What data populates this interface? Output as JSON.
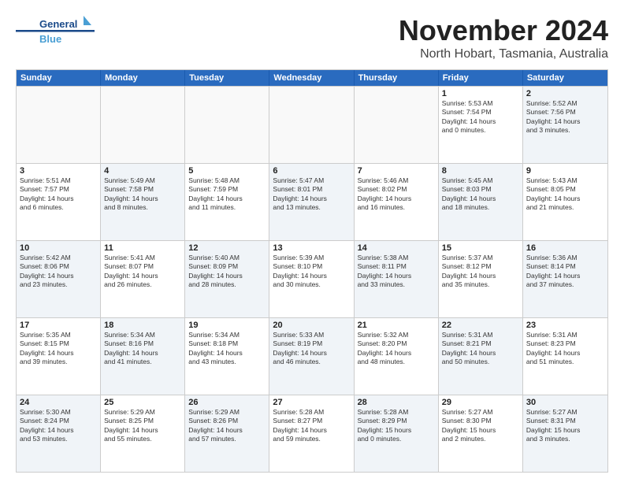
{
  "header": {
    "logo_line1": "General",
    "logo_line2": "Blue",
    "main_title": "November 2024",
    "subtitle": "North Hobart, Tasmania, Australia"
  },
  "calendar": {
    "days_of_week": [
      "Sunday",
      "Monday",
      "Tuesday",
      "Wednesday",
      "Thursday",
      "Friday",
      "Saturday"
    ],
    "rows": [
      [
        {
          "day": "",
          "empty": true
        },
        {
          "day": "",
          "empty": true
        },
        {
          "day": "",
          "empty": true
        },
        {
          "day": "",
          "empty": true
        },
        {
          "day": "",
          "empty": true
        },
        {
          "day": "1",
          "lines": [
            "Sunrise: 5:53 AM",
            "Sunset: 7:54 PM",
            "Daylight: 14 hours",
            "and 0 minutes."
          ]
        },
        {
          "day": "2",
          "lines": [
            "Sunrise: 5:52 AM",
            "Sunset: 7:56 PM",
            "Daylight: 14 hours",
            "and 3 minutes."
          ],
          "shaded": true
        }
      ],
      [
        {
          "day": "3",
          "lines": [
            "Sunrise: 5:51 AM",
            "Sunset: 7:57 PM",
            "Daylight: 14 hours",
            "and 6 minutes."
          ]
        },
        {
          "day": "4",
          "lines": [
            "Sunrise: 5:49 AM",
            "Sunset: 7:58 PM",
            "Daylight: 14 hours",
            "and 8 minutes."
          ],
          "shaded": true
        },
        {
          "day": "5",
          "lines": [
            "Sunrise: 5:48 AM",
            "Sunset: 7:59 PM",
            "Daylight: 14 hours",
            "and 11 minutes."
          ]
        },
        {
          "day": "6",
          "lines": [
            "Sunrise: 5:47 AM",
            "Sunset: 8:01 PM",
            "Daylight: 14 hours",
            "and 13 minutes."
          ],
          "shaded": true
        },
        {
          "day": "7",
          "lines": [
            "Sunrise: 5:46 AM",
            "Sunset: 8:02 PM",
            "Daylight: 14 hours",
            "and 16 minutes."
          ]
        },
        {
          "day": "8",
          "lines": [
            "Sunrise: 5:45 AM",
            "Sunset: 8:03 PM",
            "Daylight: 14 hours",
            "and 18 minutes."
          ],
          "shaded": true
        },
        {
          "day": "9",
          "lines": [
            "Sunrise: 5:43 AM",
            "Sunset: 8:05 PM",
            "Daylight: 14 hours",
            "and 21 minutes."
          ]
        }
      ],
      [
        {
          "day": "10",
          "lines": [
            "Sunrise: 5:42 AM",
            "Sunset: 8:06 PM",
            "Daylight: 14 hours",
            "and 23 minutes."
          ],
          "shaded": true
        },
        {
          "day": "11",
          "lines": [
            "Sunrise: 5:41 AM",
            "Sunset: 8:07 PM",
            "Daylight: 14 hours",
            "and 26 minutes."
          ]
        },
        {
          "day": "12",
          "lines": [
            "Sunrise: 5:40 AM",
            "Sunset: 8:09 PM",
            "Daylight: 14 hours",
            "and 28 minutes."
          ],
          "shaded": true
        },
        {
          "day": "13",
          "lines": [
            "Sunrise: 5:39 AM",
            "Sunset: 8:10 PM",
            "Daylight: 14 hours",
            "and 30 minutes."
          ]
        },
        {
          "day": "14",
          "lines": [
            "Sunrise: 5:38 AM",
            "Sunset: 8:11 PM",
            "Daylight: 14 hours",
            "and 33 minutes."
          ],
          "shaded": true
        },
        {
          "day": "15",
          "lines": [
            "Sunrise: 5:37 AM",
            "Sunset: 8:12 PM",
            "Daylight: 14 hours",
            "and 35 minutes."
          ]
        },
        {
          "day": "16",
          "lines": [
            "Sunrise: 5:36 AM",
            "Sunset: 8:14 PM",
            "Daylight: 14 hours",
            "and 37 minutes."
          ],
          "shaded": true
        }
      ],
      [
        {
          "day": "17",
          "lines": [
            "Sunrise: 5:35 AM",
            "Sunset: 8:15 PM",
            "Daylight: 14 hours",
            "and 39 minutes."
          ]
        },
        {
          "day": "18",
          "lines": [
            "Sunrise: 5:34 AM",
            "Sunset: 8:16 PM",
            "Daylight: 14 hours",
            "and 41 minutes."
          ],
          "shaded": true
        },
        {
          "day": "19",
          "lines": [
            "Sunrise: 5:34 AM",
            "Sunset: 8:18 PM",
            "Daylight: 14 hours",
            "and 43 minutes."
          ]
        },
        {
          "day": "20",
          "lines": [
            "Sunrise: 5:33 AM",
            "Sunset: 8:19 PM",
            "Daylight: 14 hours",
            "and 46 minutes."
          ],
          "shaded": true
        },
        {
          "day": "21",
          "lines": [
            "Sunrise: 5:32 AM",
            "Sunset: 8:20 PM",
            "Daylight: 14 hours",
            "and 48 minutes."
          ]
        },
        {
          "day": "22",
          "lines": [
            "Sunrise: 5:31 AM",
            "Sunset: 8:21 PM",
            "Daylight: 14 hours",
            "and 50 minutes."
          ],
          "shaded": true
        },
        {
          "day": "23",
          "lines": [
            "Sunrise: 5:31 AM",
            "Sunset: 8:23 PM",
            "Daylight: 14 hours",
            "and 51 minutes."
          ]
        }
      ],
      [
        {
          "day": "24",
          "lines": [
            "Sunrise: 5:30 AM",
            "Sunset: 8:24 PM",
            "Daylight: 14 hours",
            "and 53 minutes."
          ],
          "shaded": true
        },
        {
          "day": "25",
          "lines": [
            "Sunrise: 5:29 AM",
            "Sunset: 8:25 PM",
            "Daylight: 14 hours",
            "and 55 minutes."
          ]
        },
        {
          "day": "26",
          "lines": [
            "Sunrise: 5:29 AM",
            "Sunset: 8:26 PM",
            "Daylight: 14 hours",
            "and 57 minutes."
          ],
          "shaded": true
        },
        {
          "day": "27",
          "lines": [
            "Sunrise: 5:28 AM",
            "Sunset: 8:27 PM",
            "Daylight: 14 hours",
            "and 59 minutes."
          ]
        },
        {
          "day": "28",
          "lines": [
            "Sunrise: 5:28 AM",
            "Sunset: 8:29 PM",
            "Daylight: 15 hours",
            "and 0 minutes."
          ],
          "shaded": true
        },
        {
          "day": "29",
          "lines": [
            "Sunrise: 5:27 AM",
            "Sunset: 8:30 PM",
            "Daylight: 15 hours",
            "and 2 minutes."
          ]
        },
        {
          "day": "30",
          "lines": [
            "Sunrise: 5:27 AM",
            "Sunset: 8:31 PM",
            "Daylight: 15 hours",
            "and 3 minutes."
          ],
          "shaded": true
        }
      ]
    ]
  }
}
